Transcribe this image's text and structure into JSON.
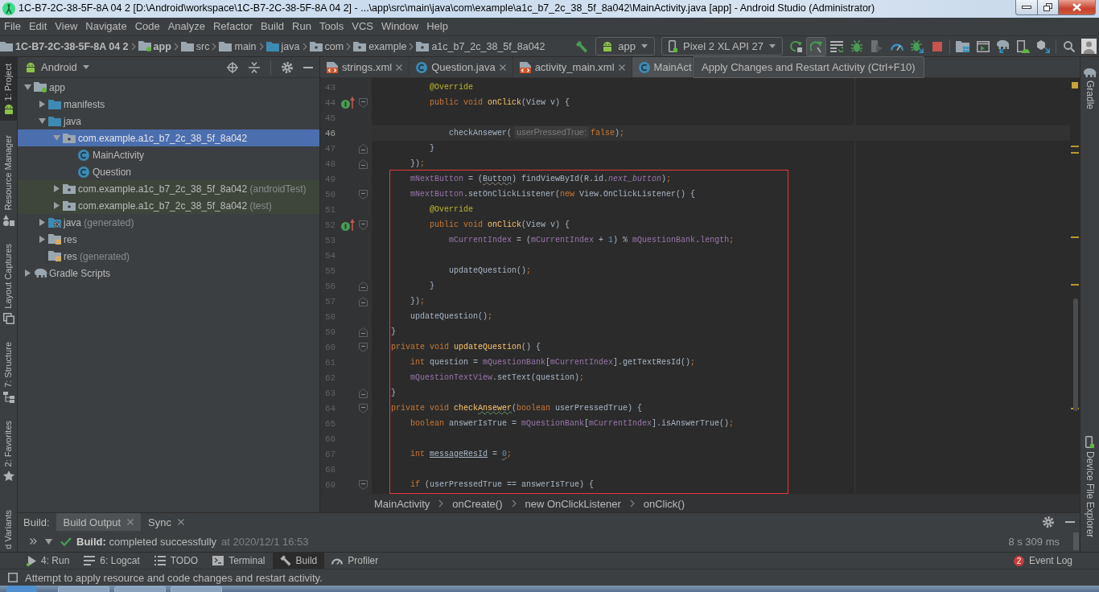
{
  "window": {
    "title": "1C-B7-2C-38-5F-8A 04 2 [D:\\Android\\workspace\\1C-B7-2C-38-5F-8A 04 2] - ...\\app\\src\\main\\java\\com\\example\\a1c_b7_2c_38_5f_8a042\\MainActivity.java [app] - Android Studio (Administrator)"
  },
  "menu": [
    "File",
    "Edit",
    "View",
    "Navigate",
    "Code",
    "Analyze",
    "Refactor",
    "Build",
    "Run",
    "Tools",
    "VCS",
    "Window",
    "Help"
  ],
  "navigation": [
    {
      "kind": "project",
      "label": "1C-B7-2C-38-5F-8A 04 2"
    },
    {
      "kind": "module",
      "label": "app"
    },
    {
      "kind": "folder",
      "label": "src"
    },
    {
      "kind": "folder",
      "label": "main"
    },
    {
      "kind": "source-folder",
      "label": "java"
    },
    {
      "kind": "package",
      "label": "com"
    },
    {
      "kind": "package",
      "label": "example"
    },
    {
      "kind": "package",
      "label": "a1c_b7_2c_38_5f_8a042"
    }
  ],
  "toolbar": [
    {
      "kind": "make",
      "hovered": false
    },
    {
      "kind": "run-config",
      "label": "app",
      "hovered": false
    },
    {
      "kind": "device",
      "label": "Pixel 2 XL API 27",
      "hovered": false
    },
    {
      "kind": "apply-code",
      "hovered": false
    },
    {
      "kind": "apply-restart",
      "hovered": true
    },
    {
      "kind": "run-list",
      "hovered": false
    },
    {
      "kind": "debug",
      "hovered": false
    },
    {
      "kind": "attach",
      "hovered": false
    },
    {
      "kind": "profile",
      "hovered": false
    },
    {
      "kind": "attach-debugger",
      "hovered": false
    },
    {
      "kind": "stop",
      "hovered": false
    },
    {
      "kind": "sdk-manager",
      "hovered": false
    },
    {
      "kind": "avd-manager",
      "hovered": false
    },
    {
      "kind": "sync",
      "hovered": false
    },
    {
      "kind": "device-manager",
      "hovered": false
    },
    {
      "kind": "project-structure",
      "hovered": false
    },
    {
      "kind": "search",
      "hovered": false
    },
    {
      "kind": "account",
      "hovered": false
    }
  ],
  "tooltip": {
    "text": "Apply Changes and Restart Activity (Ctrl+F10)"
  },
  "left_tool_strip": [
    {
      "kind": "project",
      "label": "1: Project",
      "selected": true
    },
    {
      "kind": "resources",
      "label": "Resource Manager",
      "selected": false
    },
    {
      "kind": "captures",
      "label": "Layout Captures",
      "selected": false
    },
    {
      "kind": "structure",
      "label": "7: Structure",
      "selected": false
    },
    {
      "kind": "favorites",
      "label": "2: Favorites",
      "selected": false
    },
    {
      "kind": "variants",
      "label": "d Variants",
      "selected": false
    }
  ],
  "project": {
    "view": "Android",
    "tree": [
      {
        "kind": "module",
        "label": "app",
        "expanded": true,
        "selected": false,
        "children": [
          {
            "kind": "folder",
            "label": "manifests",
            "expanded": false,
            "selected": false
          },
          {
            "kind": "folder",
            "label": "java",
            "expanded": true,
            "selected": false,
            "children": [
              {
                "kind": "package",
                "label": "com.example.a1c_b7_2c_38_5f_8a042",
                "expanded": true,
                "selected": true,
                "children": [
                  {
                    "kind": "class",
                    "label": "MainActivity",
                    "selected": false
                  },
                  {
                    "kind": "class",
                    "label": "Question",
                    "selected": false
                  }
                ]
              },
              {
                "kind": "test-package",
                "label": "com.example.a1c_b7_2c_38_5f_8a042",
                "suffix": "(androidTest)",
                "expanded": false,
                "selected": false
              },
              {
                "kind": "test-package",
                "label": "com.example.a1c_b7_2c_38_5f_8a042",
                "suffix": "(test)",
                "expanded": false,
                "selected": false
              }
            ]
          },
          {
            "kind": "generated-folder",
            "label": "java",
            "suffix": "(generated)",
            "expanded": false,
            "selected": false
          },
          {
            "kind": "res-folder",
            "label": "res",
            "expanded": false,
            "selected": false
          },
          {
            "kind": "res-folder",
            "label": "res",
            "suffix": "(generated)",
            "selected": false
          }
        ]
      },
      {
        "kind": "gradle",
        "label": "Gradle Scripts",
        "expanded": false,
        "selected": false
      }
    ]
  },
  "editor": {
    "tabs": [
      {
        "kind": "xml",
        "label": "strings.xml",
        "selected": false,
        "close": true
      },
      {
        "kind": "class",
        "label": "Question.java",
        "selected": false,
        "close": true
      },
      {
        "kind": "xml",
        "label": "activity_main.xml",
        "selected": false,
        "close": true
      },
      {
        "kind": "class",
        "label": "MainAct",
        "selected": true,
        "close": false
      }
    ],
    "lines": [
      {
        "number": "43",
        "current": false,
        "framed": false,
        "tokens": [
          {
            "kind": "annotation",
            "text": "            @Override"
          }
        ]
      },
      {
        "number": "44",
        "current": false,
        "framed": false,
        "gutter": [
          {
            "kind": "implements"
          },
          {
            "kind": "fold-start"
          }
        ],
        "tokens": [
          {
            "kind": "keyword",
            "text": "            public void "
          },
          {
            "kind": "declaration",
            "text": "onClick"
          },
          {
            "kind": "plain",
            "text": "(View v) {"
          }
        ]
      },
      {
        "number": "45",
        "current": false,
        "framed": false
      },
      {
        "number": "46",
        "current": true,
        "framed": false,
        "tokens": [
          {
            "kind": "plain",
            "text": "                checkAnsewer("
          },
          {
            "kind": "hint",
            "text": "userPressedTrue:"
          },
          {
            "kind": "keyword",
            "text": "false"
          },
          {
            "kind": "plain",
            "text": ")"
          },
          {
            "kind": "keyword",
            "text": ";"
          }
        ]
      },
      {
        "number": "47",
        "current": false,
        "framed": false,
        "gutter": [
          {
            "kind": "fold-end"
          }
        ],
        "tokens": [
          {
            "kind": "plain",
            "text": "            }"
          }
        ]
      },
      {
        "number": "48",
        "current": false,
        "framed": false,
        "gutter": [
          {
            "kind": "fold-end"
          }
        ],
        "tokens": [
          {
            "kind": "plain",
            "text": "        })"
          },
          {
            "kind": "keyword",
            "text": ";"
          }
        ]
      },
      {
        "number": "49",
        "current": false,
        "framed": true,
        "tokens": [
          {
            "kind": "field",
            "text": "        mNextButton"
          },
          {
            "kind": "plain",
            "text": " = ("
          },
          {
            "kind": "plain-wavy",
            "text": "Button"
          },
          {
            "kind": "plain",
            "text": ") findViewById(R.id."
          },
          {
            "kind": "static",
            "text": "next_button"
          },
          {
            "kind": "plain",
            "text": ")"
          },
          {
            "kind": "keyword",
            "text": ";"
          }
        ]
      },
      {
        "number": "50",
        "current": false,
        "framed": true,
        "gutter": [
          {
            "kind": "fold-start"
          }
        ],
        "tokens": [
          {
            "kind": "field",
            "text": "        mNextButton"
          },
          {
            "kind": "plain",
            "text": ".setOnClickListener("
          },
          {
            "kind": "keyword",
            "text": "new "
          },
          {
            "kind": "plain",
            "text": "View.OnClickListener() {"
          }
        ]
      },
      {
        "number": "51",
        "current": false,
        "framed": true,
        "tokens": [
          {
            "kind": "annotation",
            "text": "            @Override"
          }
        ]
      },
      {
        "number": "52",
        "current": false,
        "framed": true,
        "gutter": [
          {
            "kind": "implements"
          },
          {
            "kind": "fold-start"
          }
        ],
        "tokens": [
          {
            "kind": "keyword",
            "text": "            public void "
          },
          {
            "kind": "declaration",
            "text": "onClick"
          },
          {
            "kind": "plain",
            "text": "(View v) {"
          }
        ]
      },
      {
        "number": "53",
        "current": false,
        "framed": true,
        "tokens": [
          {
            "kind": "field",
            "text": "                mCurrentIndex"
          },
          {
            "kind": "plain",
            "text": " = ("
          },
          {
            "kind": "field",
            "text": "mCurrentIndex"
          },
          {
            "kind": "plain",
            "text": " + "
          },
          {
            "kind": "number",
            "text": "1"
          },
          {
            "kind": "plain",
            "text": ") % "
          },
          {
            "kind": "field",
            "text": "mQuestionBank"
          },
          {
            "kind": "plain",
            "text": "."
          },
          {
            "kind": "field",
            "text": "length"
          },
          {
            "kind": "keyword",
            "text": ";"
          }
        ]
      },
      {
        "number": "54",
        "current": false,
        "framed": true
      },
      {
        "number": "55",
        "current": false,
        "framed": true,
        "tokens": [
          {
            "kind": "plain",
            "text": "                updateQuestion()"
          },
          {
            "kind": "keyword",
            "text": ";"
          }
        ]
      },
      {
        "number": "56",
        "current": false,
        "framed": true,
        "gutter": [
          {
            "kind": "fold-end"
          }
        ],
        "tokens": [
          {
            "kind": "plain",
            "text": "            }"
          }
        ]
      },
      {
        "number": "57",
        "current": false,
        "framed": true,
        "gutter": [
          {
            "kind": "fold-end"
          }
        ],
        "tokens": [
          {
            "kind": "plain",
            "text": "        })"
          },
          {
            "kind": "keyword",
            "text": ";"
          }
        ]
      },
      {
        "number": "58",
        "current": false,
        "framed": true,
        "tokens": [
          {
            "kind": "plain",
            "text": "        updateQuestion()"
          },
          {
            "kind": "keyword",
            "text": ";"
          }
        ]
      },
      {
        "number": "59",
        "current": false,
        "framed": true,
        "gutter": [
          {
            "kind": "fold-end"
          }
        ],
        "tokens": [
          {
            "kind": "plain",
            "text": "    }"
          }
        ]
      },
      {
        "number": "60",
        "current": false,
        "framed": true,
        "gutter": [
          {
            "kind": "fold-start"
          }
        ],
        "tokens": [
          {
            "kind": "keyword",
            "text": "    private void "
          },
          {
            "kind": "declaration",
            "text": "updateQuestion"
          },
          {
            "kind": "plain",
            "text": "() {"
          }
        ]
      },
      {
        "number": "61",
        "current": false,
        "framed": true,
        "tokens": [
          {
            "kind": "keyword",
            "text": "        int "
          },
          {
            "kind": "plain",
            "text": "question = "
          },
          {
            "kind": "field",
            "text": "mQuestionBank"
          },
          {
            "kind": "plain",
            "text": "["
          },
          {
            "kind": "field",
            "text": "mCurrentIndex"
          },
          {
            "kind": "plain",
            "text": "].getTextResId()"
          },
          {
            "kind": "keyword",
            "text": ";"
          }
        ]
      },
      {
        "number": "62",
        "current": false,
        "framed": true,
        "tokens": [
          {
            "kind": "field",
            "text": "        mQuestionTextView"
          },
          {
            "kind": "plain",
            "text": ".setText(question)"
          },
          {
            "kind": "keyword",
            "text": ";"
          }
        ]
      },
      {
        "number": "63",
        "current": false,
        "framed": true,
        "gutter": [
          {
            "kind": "fold-end"
          }
        ],
        "tokens": [
          {
            "kind": "plain",
            "text": "    }"
          }
        ]
      },
      {
        "number": "64",
        "current": false,
        "framed": true,
        "gutter": [
          {
            "kind": "fold-start"
          }
        ],
        "tokens": [
          {
            "kind": "keyword",
            "text": "    private void "
          },
          {
            "kind": "declaration",
            "text": "check"
          },
          {
            "kind": "declaration-typo",
            "text": "Ansewer"
          },
          {
            "kind": "plain",
            "text": "("
          },
          {
            "kind": "keyword",
            "text": "boolean "
          },
          {
            "kind": "plain",
            "text": "userPressedTrue) {"
          }
        ]
      },
      {
        "number": "65",
        "current": false,
        "framed": true,
        "tokens": [
          {
            "kind": "keyword",
            "text": "        boolean "
          },
          {
            "kind": "plain",
            "text": "answerIsTrue = "
          },
          {
            "kind": "field",
            "text": "mQuestionBank"
          },
          {
            "kind": "plain",
            "text": "["
          },
          {
            "kind": "field",
            "text": "mCurrentIndex"
          },
          {
            "kind": "plain",
            "text": "].isAnswerTrue()"
          },
          {
            "kind": "keyword",
            "text": ";"
          }
        ]
      },
      {
        "number": "66",
        "current": false,
        "framed": true
      },
      {
        "number": "67",
        "current": false,
        "framed": true,
        "tokens": [
          {
            "kind": "keyword",
            "text": "        int "
          },
          {
            "kind": "plain-underlined",
            "text": "messageResId"
          },
          {
            "kind": "plain",
            "text": " = "
          },
          {
            "kind": "number-wavy",
            "text": "0"
          },
          {
            "kind": "keyword",
            "text": ";"
          }
        ]
      },
      {
        "number": "68",
        "current": false,
        "framed": true
      },
      {
        "number": "69",
        "current": false,
        "framed": true,
        "gutter": [
          {
            "kind": "fold-start"
          }
        ],
        "tokens": [
          {
            "kind": "keyword",
            "text": "        if "
          },
          {
            "kind": "plain",
            "text": "(userPressedTrue == answerIsTrue) {"
          }
        ]
      }
    ],
    "breadcrumbs": [
      "MainActivity",
      "onCreate()",
      "new OnClickListener",
      "onClick()"
    ]
  },
  "right_tool_strip": [
    {
      "kind": "gradle",
      "label": "Gradle"
    },
    {
      "kind": "device-explorer",
      "label": "Device File Explorer"
    }
  ],
  "build": {
    "title": "Build:",
    "tabs": [
      {
        "label": "Build Output",
        "selected": true
      },
      {
        "label": "Sync",
        "selected": false
      }
    ],
    "rows": [
      {
        "kind": "success",
        "expanded": true,
        "message": "**Build:** completed successfully",
        "time": "at 2020/12/1 16:53",
        "duration": "8 s 309 ms"
      }
    ]
  },
  "tool_buttons": [
    {
      "kind": "run",
      "label": "4: Run",
      "selected": false
    },
    {
      "kind": "logcat",
      "label": "6: Logcat",
      "selected": false
    },
    {
      "kind": "todo",
      "label": "TODO",
      "selected": false
    },
    {
      "kind": "terminal",
      "label": "Terminal",
      "selected": false
    },
    {
      "kind": "build",
      "label": "Build",
      "selected": true
    },
    {
      "kind": "profiler",
      "label": "Profiler",
      "selected": false
    }
  ],
  "event_log": {
    "label": "Event Log",
    "count": "2"
  },
  "status_bar": {
    "message": "Attempt to apply resource and code changes and restart activity."
  }
}
